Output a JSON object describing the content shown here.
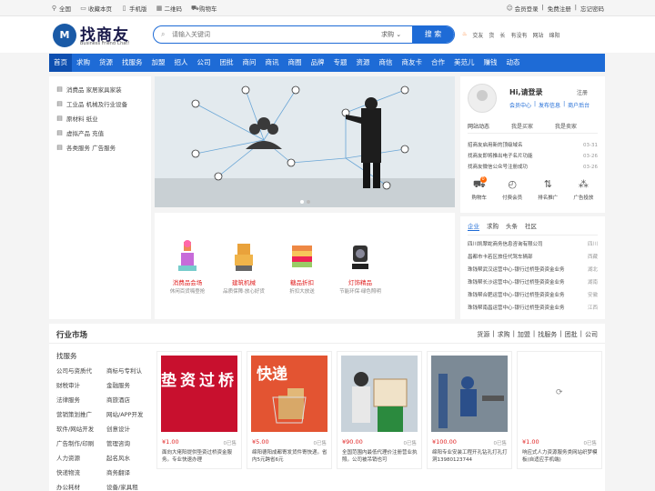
{
  "topbar": {
    "left": [
      {
        "icon": "location-icon",
        "label": "全国"
      },
      {
        "icon": "bookmark-icon",
        "label": "收藏本页"
      },
      {
        "icon": "mobile-icon",
        "label": "手机版"
      },
      {
        "icon": "qrcode-icon",
        "label": "二维码"
      },
      {
        "icon": "cart-icon",
        "label": "购物车"
      }
    ],
    "right": {
      "user_label": "会员登录",
      "sep1": "|",
      "register": "免费注册",
      "sep2": "|",
      "forgot": "忘记密码"
    }
  },
  "header": {
    "logo_mark": "M",
    "logo_name": "找商友",
    "logo_sub": "Business Friend Chat!",
    "search_placeholder": "请输入关键词",
    "search_category": "求购 ⌄",
    "search_button": "搜 索",
    "hot_words": [
      "交友",
      "货",
      "长",
      "有没有",
      "网站",
      "绵阳"
    ]
  },
  "nav": [
    "首页",
    "求购",
    "货源",
    "找服务",
    "加盟",
    "招人",
    "公司",
    "团批",
    "商问",
    "商讯",
    "商圈",
    "品牌",
    "专题",
    "资源",
    "商信",
    "商友卡",
    "合作",
    "美范儿",
    "赚钱",
    "动态"
  ],
  "categories": [
    {
      "icon": "list-icon",
      "label": "消费品 家居家具家装"
    },
    {
      "icon": "list-icon",
      "label": "工业品 机械及行业设备"
    },
    {
      "icon": "list-icon",
      "label": "原材料 纸业"
    },
    {
      "icon": "list-icon",
      "label": "虚拟产品 充值"
    },
    {
      "icon": "list-icon",
      "label": "各类服务 广告服务"
    }
  ],
  "products": [
    {
      "title": "消费品会场",
      "sub": "休闲百货嗨登抢"
    },
    {
      "title": "建筑机械",
      "sub": "品质保障·放心好货"
    },
    {
      "title": "糖品折扣",
      "sub": "折扣大放送"
    },
    {
      "title": "灯饰精品",
      "sub": "节能环保·绿色照明"
    }
  ],
  "user": {
    "greeting": "Hi,请登录",
    "register": "注册",
    "links": [
      "会员中心",
      "|",
      "发布信息",
      "|",
      "商户后台"
    ],
    "tabs": [
      "网站动态",
      "我是买家",
      "我是卖家"
    ],
    "news": [
      {
        "title": "招商友启用新的顶级域名",
        "date": "03-31"
      },
      {
        "title": "找商友即将推出电子名片功能",
        "date": "03-26"
      },
      {
        "title": "找商友微信公众号注册成功",
        "date": "03-26"
      }
    ],
    "icons": [
      {
        "icon": "cart-icon",
        "label": "购物车",
        "badge": "0"
      },
      {
        "icon": "payment-icon",
        "label": "付费会员"
      },
      {
        "icon": "ranking-icon",
        "label": "排名推广"
      },
      {
        "icon": "ad-icon",
        "label": "广告投放"
      }
    ]
  },
  "biz": {
    "tabs": [
      "企业",
      "求购",
      "头条",
      "社区"
    ],
    "rows": [
      {
        "name": "四川凯翠蛇商务信息咨询有限公司",
        "region": "四川"
      },
      {
        "name": "昌都市卡若区旅佳代驾车辆部",
        "region": "西藏"
      },
      {
        "name": "珠钱帮武汉运营中心-银行过桥垫资资金业务",
        "region": "湖北"
      },
      {
        "name": "珠钱帮长沙运营中心-银行过桥垫资资金业务",
        "region": "湖南"
      },
      {
        "name": "珠钱帮合肥运营中心-银行过桥垫资资金业务",
        "region": "安徽"
      },
      {
        "name": "珠钱帮南昌运营中心-银行过桥垫资资金业务",
        "region": "江西"
      }
    ]
  },
  "market": {
    "title": "行业市场",
    "links": [
      "货源",
      "|",
      "求购",
      "|",
      "加盟",
      "|",
      "找服务",
      "|",
      "团批",
      "|",
      "公司"
    ],
    "sub_title": "找服务",
    "services": [
      "公司与资质代",
      "商标与专利认",
      "财税审计",
      "金融服务",
      "法律服务",
      "商旅酒店",
      "营销策划推广",
      "网站/APP开发",
      "软件/网站开发",
      "创意设计",
      "广告制作/印刷",
      "管理咨询",
      "人力资源",
      "起名风水",
      "快递物流",
      "商务翻译",
      "办公耗材",
      "设备/家具租"
    ],
    "cards": [
      {
        "price": "¥1.00",
        "sold": "0已售",
        "desc": "面向大佬阳提供垫资过桥资金服务。专业快速办理",
        "img_text": "垫资过桥"
      },
      {
        "price": "¥5.00",
        "sold": "0已售",
        "desc": "绵阳德阳成都寄发货件寄快递。省内5元跨省6元",
        "img_text": "快递"
      },
      {
        "price": "¥90.00",
        "sold": "0已售",
        "desc": "全国范围内最低代理价注册营业执照。公司被吊销也可",
        "img_text": ""
      },
      {
        "price": "¥100.00",
        "sold": "0已售",
        "desc": "绵阳专业安装工程开孔钻孔打孔打洞13980123744",
        "img_text": ""
      },
      {
        "price": "¥1.00",
        "sold": "0已售",
        "desc": "响应式人力资源服务类网站织梦模板(自适应手机端)",
        "img_text": ""
      }
    ]
  }
}
